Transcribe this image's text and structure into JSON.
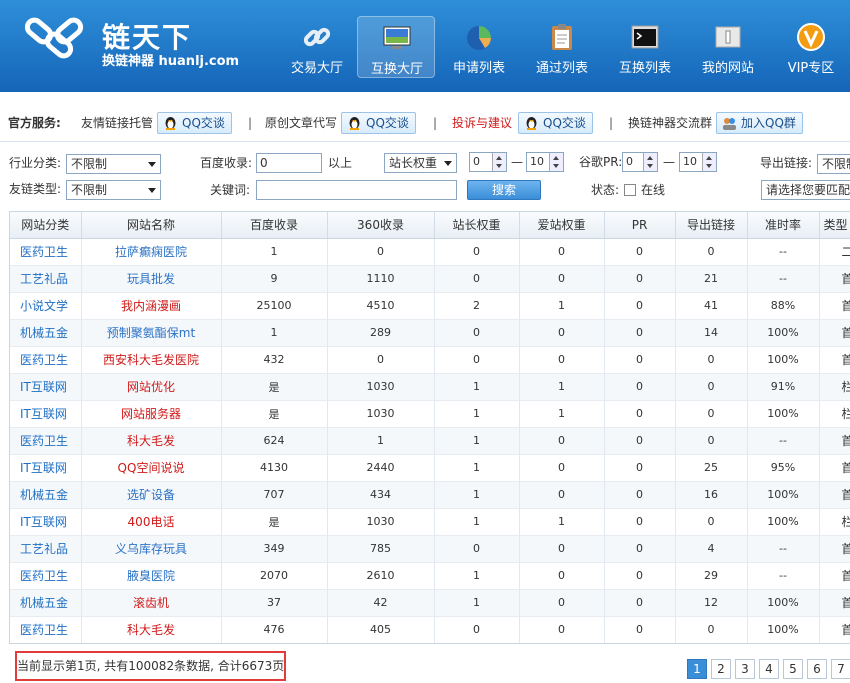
{
  "header": {
    "logo_title": "链天下",
    "logo_sub": "换链神器 huanlj.com",
    "nav": [
      {
        "label": "交易大厅",
        "icon": "chain-link-icon",
        "active": false
      },
      {
        "label": "互换大厅",
        "icon": "monitor-icon",
        "active": true
      },
      {
        "label": "申请列表",
        "icon": "pie-chart-icon",
        "active": false
      },
      {
        "label": "通过列表",
        "icon": "clipboard-icon",
        "active": false
      },
      {
        "label": "互换列表",
        "icon": "terminal-icon",
        "active": false
      },
      {
        "label": "我的网站",
        "icon": "document-icon",
        "active": false
      },
      {
        "label": "VIP专区",
        "icon": "vip-badge-icon",
        "active": false
      }
    ]
  },
  "services": {
    "title": "官方服务:",
    "items": [
      {
        "label": "友情链接托管",
        "button": "QQ交谈",
        "highlight": false
      },
      {
        "label": "原创文章代写",
        "button": "QQ交谈",
        "highlight": false
      },
      {
        "label": "投诉与建议",
        "button": "QQ交谈",
        "highlight": true
      },
      {
        "label": "换链神器交流群",
        "button": "加入QQ群",
        "highlight": false
      }
    ],
    "separator": "|"
  },
  "filters": {
    "industry_label": "行业分类:",
    "industry_value": "不限制",
    "linktype_label": "友链类型:",
    "linktype_value": "不限制",
    "baidu_label": "百度收录:",
    "baidu_value": "0",
    "above_label": "以上",
    "weight_select": "站长权重",
    "weight_min": "0",
    "weight_max": "10",
    "dash": "—",
    "google_label": "谷歌PR:",
    "pr_min": "0",
    "pr_max": "10",
    "export_label": "导出链接:",
    "export_value": "不限制",
    "keyword_label": "关键词:",
    "keyword_value": "",
    "search_button": "搜索",
    "state_label": "状态:",
    "online_label": "在线",
    "match_placeholder": "请选择您要匹配的"
  },
  "table": {
    "columns": [
      "网站分类",
      "网站名称",
      "百度收录",
      "360收录",
      "站长权重",
      "爱站权重",
      "PR",
      "导出链接",
      "准时率",
      "类型"
    ],
    "rows": [
      {
        "cat": "医药卫生",
        "name": "拉萨癫痫医院",
        "color": "blue",
        "baidu": "1",
        "s360": "0",
        "w1": "0",
        "w2": "0",
        "pr": "0",
        "out": "0",
        "rate": "--",
        "type": "二级域"
      },
      {
        "cat": "工艺礼品",
        "name": "玩具批发",
        "color": "blue",
        "baidu": "9",
        "s360": "1110",
        "w1": "0",
        "w2": "0",
        "pr": "0",
        "out": "21",
        "rate": "--",
        "type": "首页"
      },
      {
        "cat": "小说文学",
        "name": "我内涵漫画",
        "color": "red",
        "baidu": "25100",
        "s360": "4510",
        "w1": "2",
        "w2": "1",
        "pr": "0",
        "out": "41",
        "rate": "88%",
        "type": "首页"
      },
      {
        "cat": "机械五金",
        "name": "预制聚氨酯保mt",
        "color": "blue",
        "baidu": "1",
        "s360": "289",
        "w1": "0",
        "w2": "0",
        "pr": "0",
        "out": "14",
        "rate": "100%",
        "type": "首页"
      },
      {
        "cat": "医药卫生",
        "name": "西安科大毛发医院",
        "color": "red",
        "baidu": "432",
        "s360": "0",
        "w1": "0",
        "w2": "0",
        "pr": "0",
        "out": "0",
        "rate": "100%",
        "type": "首页"
      },
      {
        "cat": "IT互联网",
        "name": "网站优化",
        "color": "red",
        "baidu": "是",
        "s360": "1030",
        "w1": "1",
        "w2": "1",
        "pr": "0",
        "out": "0",
        "rate": "91%",
        "type": "栏目"
      },
      {
        "cat": "IT互联网",
        "name": "网站服务器",
        "color": "red",
        "baidu": "是",
        "s360": "1030",
        "w1": "1",
        "w2": "1",
        "pr": "0",
        "out": "0",
        "rate": "100%",
        "type": "栏目"
      },
      {
        "cat": "医药卫生",
        "name": "科大毛发",
        "color": "red",
        "baidu": "624",
        "s360": "1",
        "w1": "1",
        "w2": "0",
        "pr": "0",
        "out": "0",
        "rate": "--",
        "type": "首页"
      },
      {
        "cat": "IT互联网",
        "name": "QQ空间说说",
        "color": "red",
        "baidu": "4130",
        "s360": "2440",
        "w1": "1",
        "w2": "0",
        "pr": "0",
        "out": "25",
        "rate": "95%",
        "type": "首页"
      },
      {
        "cat": "机械五金",
        "name": "选矿设备",
        "color": "blue",
        "baidu": "707",
        "s360": "434",
        "w1": "1",
        "w2": "0",
        "pr": "0",
        "out": "16",
        "rate": "100%",
        "type": "首页"
      },
      {
        "cat": "IT互联网",
        "name": "400电话",
        "color": "red",
        "baidu": "是",
        "s360": "1030",
        "w1": "1",
        "w2": "1",
        "pr": "0",
        "out": "0",
        "rate": "100%",
        "type": "栏目"
      },
      {
        "cat": "工艺礼品",
        "name": "义乌库存玩具",
        "color": "blue",
        "baidu": "349",
        "s360": "785",
        "w1": "0",
        "w2": "0",
        "pr": "0",
        "out": "4",
        "rate": "--",
        "type": "首页"
      },
      {
        "cat": "医药卫生",
        "name": "腋臭医院",
        "color": "blue",
        "baidu": "2070",
        "s360": "2610",
        "w1": "1",
        "w2": "0",
        "pr": "0",
        "out": "29",
        "rate": "--",
        "type": "首页"
      },
      {
        "cat": "机械五金",
        "name": "滚齿机",
        "color": "red",
        "baidu": "37",
        "s360": "42",
        "w1": "1",
        "w2": "0",
        "pr": "0",
        "out": "12",
        "rate": "100%",
        "type": "首页"
      },
      {
        "cat": "医药卫生",
        "name": "科大毛发",
        "color": "red",
        "baidu": "476",
        "s360": "405",
        "w1": "0",
        "w2": "0",
        "pr": "0",
        "out": "0",
        "rate": "100%",
        "type": "首页"
      }
    ]
  },
  "footer": {
    "status_text": "当前显示第1页, 共有100082条数据, 合计6673页",
    "pages": [
      "1",
      "2",
      "3",
      "4",
      "5",
      "6",
      "7"
    ],
    "current_page": "1"
  }
}
